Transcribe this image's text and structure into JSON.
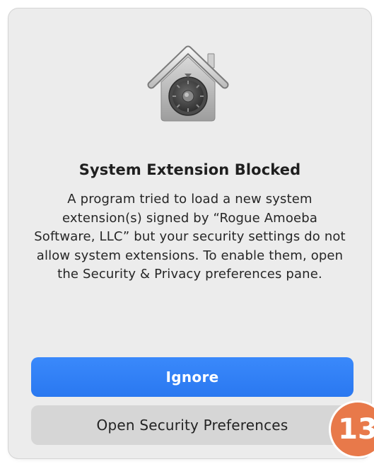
{
  "dialog": {
    "title": "System Extension Blocked",
    "message": "A program tried to load a new system extension(s) signed by “Rogue Amoeba Software, LLC” but your security settings do not allow system extensions. To enable them, open the Security & Privacy preferences pane.",
    "icon": "lock-house-vault-icon"
  },
  "buttons": {
    "ignore_label": "Ignore",
    "open_prefs_label": "Open Security Preferences"
  },
  "annotation": {
    "step_number": "13"
  },
  "colors": {
    "primary_button": "#2f7ff5",
    "secondary_button": "#d6d6d6",
    "dialog_background": "#ececec",
    "badge": "#e8794a"
  }
}
